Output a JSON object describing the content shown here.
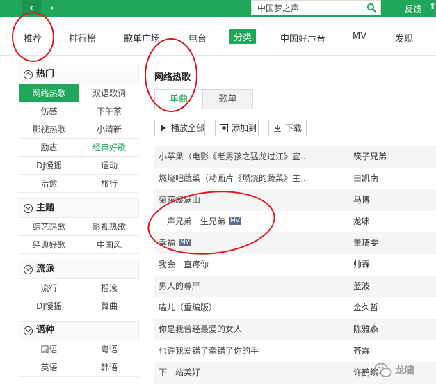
{
  "topbar": {
    "search_value": "中国梦之声",
    "feedback": "反馈",
    "back_glyph": "‹",
    "forward_glyph": "›",
    "upload_glyph": "⬆"
  },
  "nav_tabs": [
    {
      "label": "推荐"
    },
    {
      "label": "排行榜"
    },
    {
      "label": "歌单广场"
    },
    {
      "label": "电台"
    },
    {
      "label": "分类",
      "active": true
    },
    {
      "label": "中国好声音"
    },
    {
      "label": "MV"
    },
    {
      "label": "发现"
    }
  ],
  "sidebar": {
    "groups": [
      {
        "title": "热门",
        "items": [
          "网络热歌",
          "双语歌词",
          "伤感",
          "下午茶",
          "影视热歌",
          "小清新",
          "励志",
          "经典好歌",
          "DJ慢摇",
          "运动",
          "治愈",
          "旅行"
        ]
      },
      {
        "title": "主题",
        "items": [
          "综艺热歌",
          "影视热歌",
          "经典好歌",
          "中国风"
        ]
      },
      {
        "title": "流派",
        "items": [
          "流行",
          "摇滚",
          "DJ慢摇",
          "舞曲"
        ]
      },
      {
        "title": "语种",
        "items": [
          "国语",
          "粤语",
          "英语",
          "韩语"
        ]
      }
    ]
  },
  "content": {
    "title": "网络热歌",
    "subtabs": [
      "单曲",
      "歌单"
    ],
    "actions": {
      "play_all": "播放全部",
      "add_to": "添加到",
      "download": "下载"
    },
    "mv_tag": "MV",
    "songs": [
      {
        "title": "小苹果（电影《老男孩之猛龙过江》宣...",
        "artist": "筷子兄弟"
      },
      {
        "title": "燃烧吧蔬菜（动画片《燃烧的蔬菜》主...",
        "artist": "白凯南"
      },
      {
        "title": "菊花爆满山",
        "artist": "马博"
      },
      {
        "title": "一声兄弟一生兄弟",
        "artist": "龙啸",
        "mv": true
      },
      {
        "title": "幸福",
        "artist": "董琦雯",
        "mv": true
      },
      {
        "title": "我会一直疼你",
        "artist": "帅霖"
      },
      {
        "title": "男人的尊严",
        "artist": "蓝波"
      },
      {
        "title": "嗑儿（重编版）",
        "artist": "金久哲"
      },
      {
        "title": "你是我曾经最爱的女人",
        "artist": "陈雅森"
      },
      {
        "title": "也许我爱错了牵错了你的手",
        "artist": "齐霖"
      },
      {
        "title": "下一站美好",
        "artist": "许鹤缤"
      }
    ]
  },
  "watermark": {
    "text": "龙啸"
  },
  "colors": {
    "brand_green": "#1fa65a",
    "annotation_red": "#e3141b",
    "mv_tag_bg": "#5f6e8c"
  }
}
